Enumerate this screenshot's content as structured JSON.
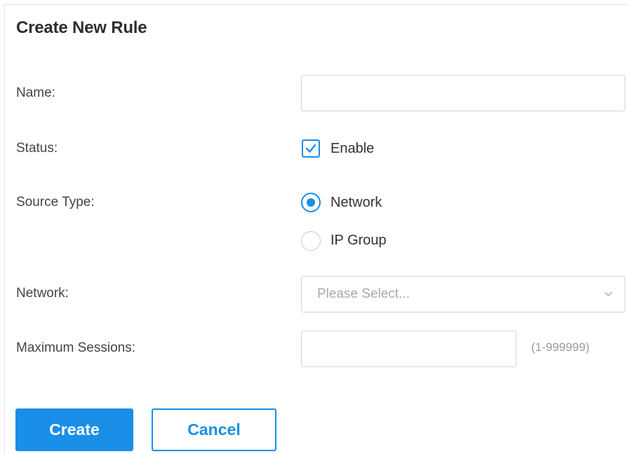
{
  "form": {
    "title": "Create New Rule",
    "name": {
      "label": "Name:",
      "value": "",
      "placeholder": ""
    },
    "status": {
      "label": "Status:",
      "option_label": "Enable",
      "checked": true
    },
    "source_type": {
      "label": "Source Type:",
      "options": [
        {
          "label": "Network",
          "selected": true
        },
        {
          "label": "IP Group",
          "selected": false
        }
      ]
    },
    "network": {
      "label": "Network:",
      "placeholder": "Please Select...",
      "icon": "chevron-down-icon"
    },
    "max_sessions": {
      "label": "Maximum Sessions:",
      "value": "",
      "range_hint": "(1-999999)"
    }
  },
  "actions": {
    "create_label": "Create",
    "cancel_label": "Cancel"
  },
  "colors": {
    "accent": "#1a8fe8",
    "label_text": "#444444",
    "border": "#d6d6d6",
    "placeholder": "#a8a8a8"
  }
}
